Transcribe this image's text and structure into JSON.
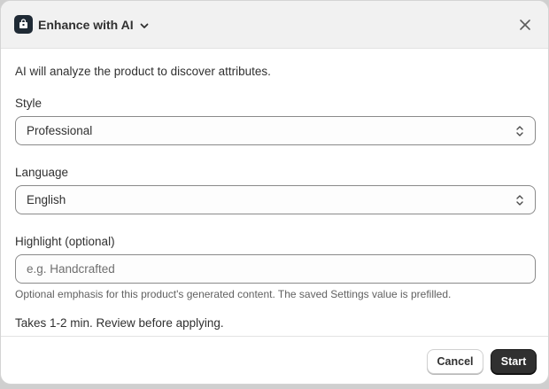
{
  "dialog": {
    "title": "Enhance with AI",
    "intro": "AI will analyze the product to discover attributes.",
    "style": {
      "label": "Style",
      "selected": "Professional"
    },
    "language": {
      "label": "Language",
      "selected": "English"
    },
    "highlight": {
      "label": "Highlight (optional)",
      "value": "",
      "placeholder": "e.g. Handcrafted",
      "help": "Optional emphasis for this product's generated content. The saved Settings value is prefilled."
    },
    "note": "Takes 1-2 min. Review before applying."
  },
  "footer": {
    "cancel_label": "Cancel",
    "start_label": "Start"
  },
  "icons": {
    "app": "magic-bag-icon",
    "chevron": "chevron-down-icon",
    "close": "close-icon",
    "select": "select-updown-icon"
  },
  "colors": {
    "primary_button": "#303030",
    "header_bg": "#f1f1f1",
    "app_icon_bg": "#1f2a35"
  }
}
